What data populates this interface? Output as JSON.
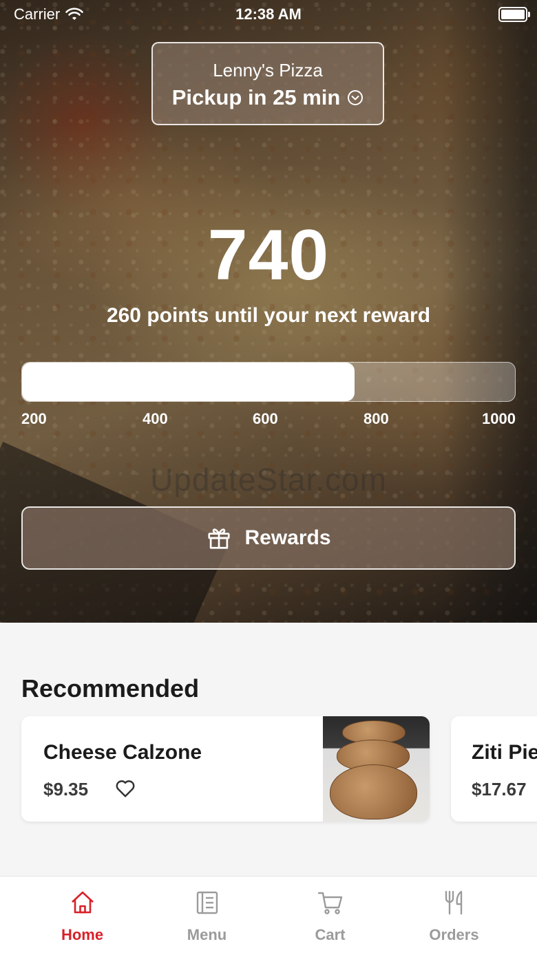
{
  "status_bar": {
    "carrier": "Carrier",
    "time": "12:38 AM"
  },
  "location": {
    "store": "Lenny's Pizza",
    "pickup": "Pickup in 25 min",
    "icon": "chevron-down-circle-icon"
  },
  "rewards": {
    "points": "740",
    "subtext": "260 points until your next reward",
    "progress_value": 740,
    "progress_min": 200,
    "progress_max": 1000,
    "ticks": [
      "200",
      "400",
      "600",
      "800",
      "1000"
    ],
    "button_label": "Rewards",
    "button_icon": "gift-icon"
  },
  "watermark": "UpdateStar.com",
  "recommended": {
    "title": "Recommended",
    "items": [
      {
        "name": "Cheese Calzone",
        "price": "$9.35"
      },
      {
        "name": "Ziti Pie",
        "price": "$17.67"
      }
    ]
  },
  "tabbar": {
    "tabs": [
      {
        "label": "Home",
        "icon": "home-icon",
        "active": true
      },
      {
        "label": "Menu",
        "icon": "menu-icon",
        "active": false
      },
      {
        "label": "Cart",
        "icon": "cart-icon",
        "active": false
      },
      {
        "label": "Orders",
        "icon": "utensils-icon",
        "active": false
      }
    ]
  },
  "colors": {
    "accent": "#d8202a",
    "inactive": "#9b9b9b"
  }
}
